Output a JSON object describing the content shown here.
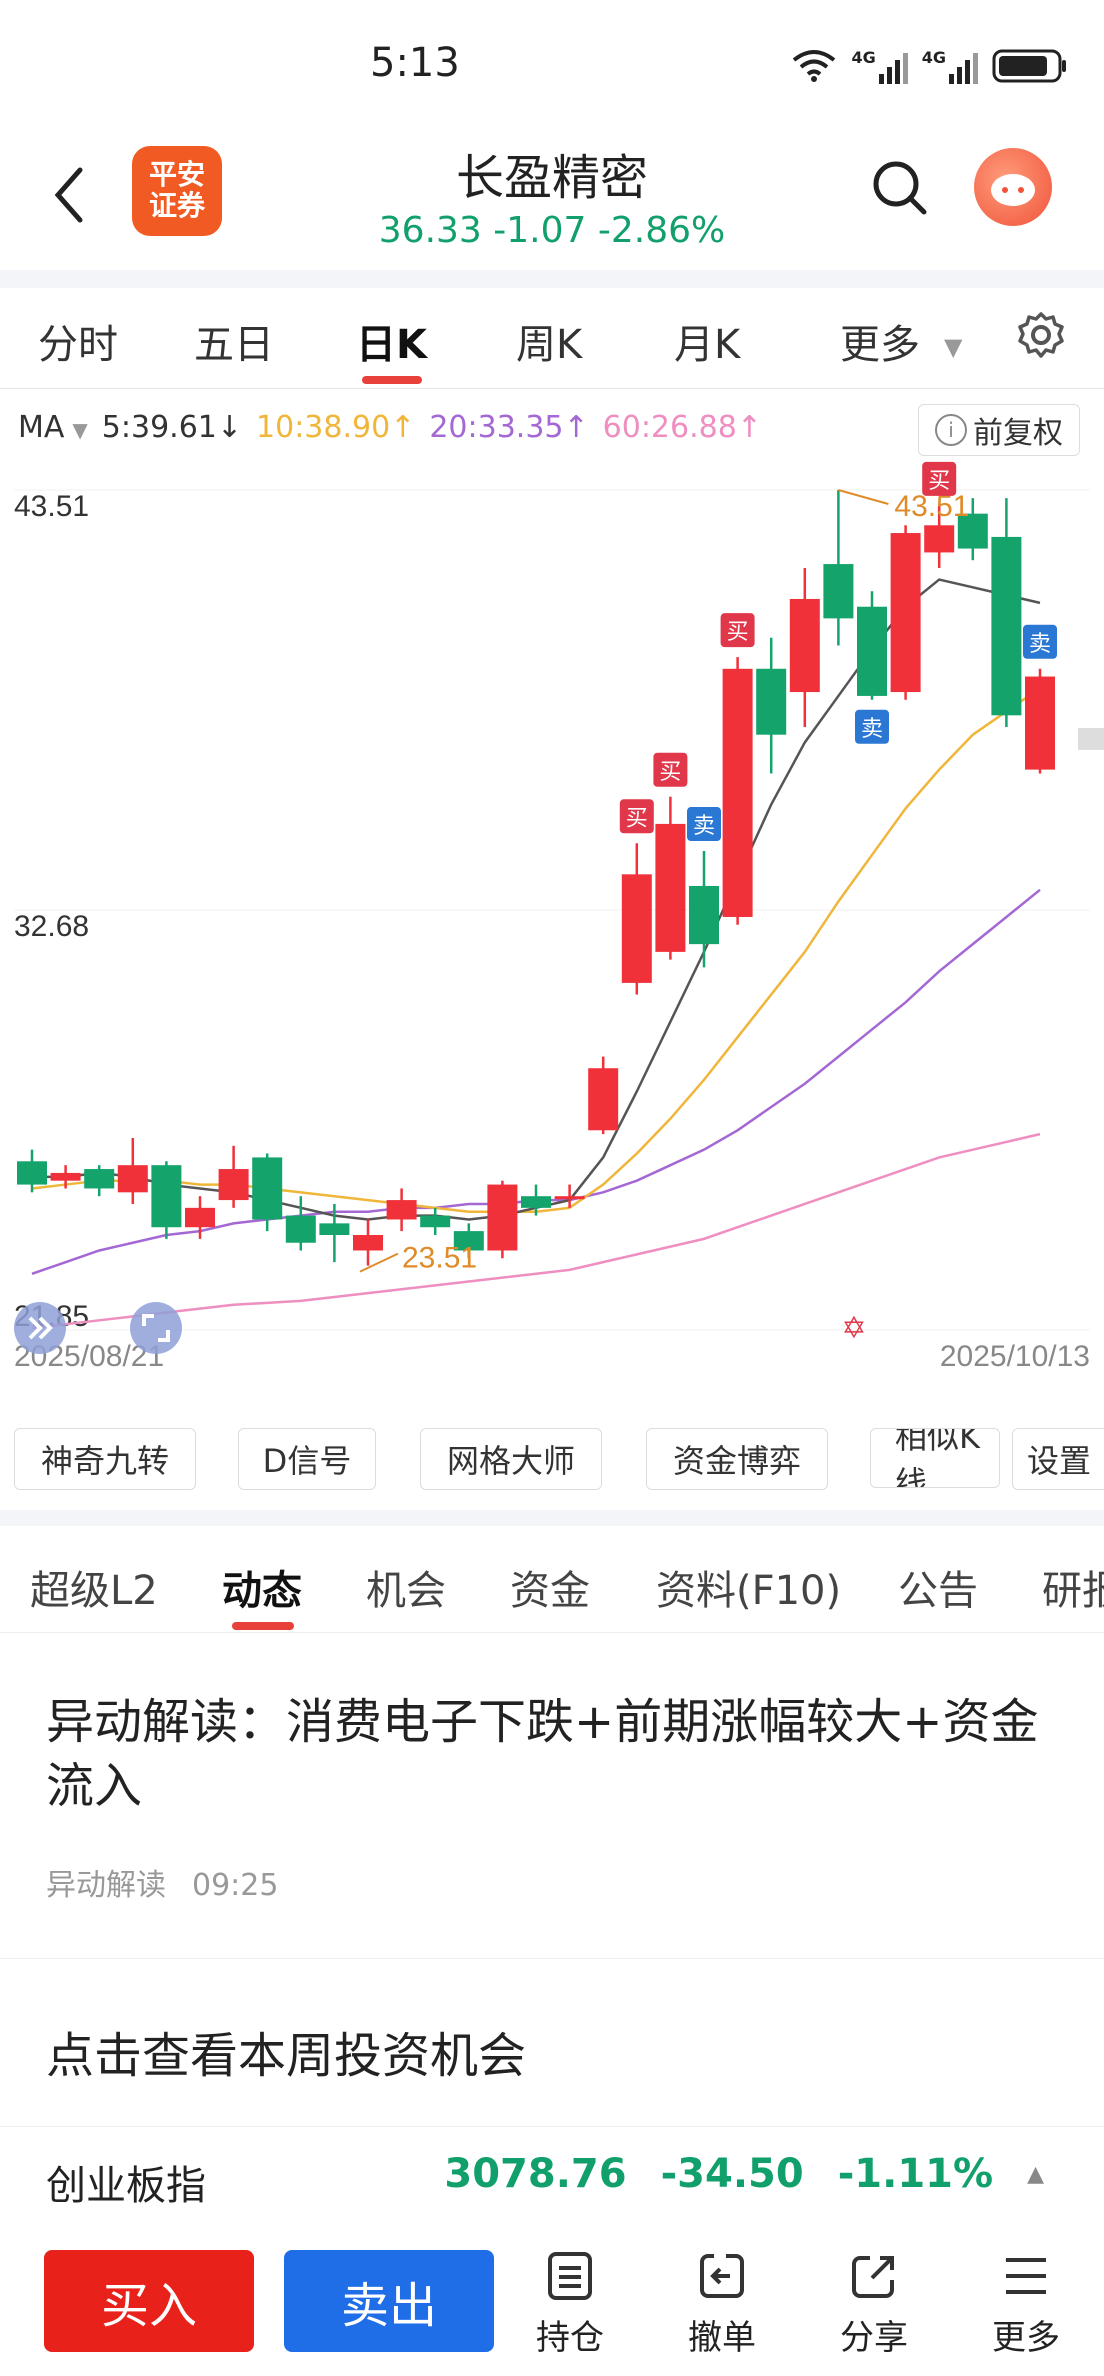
{
  "status": {
    "time": "5:13",
    "net1": "4G",
    "net2": "4G"
  },
  "header": {
    "name": "长盈精密",
    "price_line": "36.33  -1.07  -2.86%",
    "logo_line1": "平安",
    "logo_line2": "证券"
  },
  "tabs": [
    {
      "label": "分时"
    },
    {
      "label": "五日"
    },
    {
      "label": "日K"
    },
    {
      "label": "周K"
    },
    {
      "label": "月K"
    },
    {
      "label": "更多"
    }
  ],
  "ma": {
    "label": "MA",
    "ma5": "5:39.61↓",
    "ma10": "10:38.90↑",
    "ma20": "20:33.35↑",
    "ma60": "60:26.88↑",
    "adjust": "前复权"
  },
  "colors": {
    "up": "#f0313a",
    "down": "#13a36b",
    "ma5": "#555555",
    "ma10": "#f0b63a",
    "ma20": "#a468d4",
    "ma60": "#ef8ec0",
    "accent": "#e8413a",
    "blue": "#1f6ee8"
  },
  "chart_data": {
    "type": "candlestick",
    "y_ticks": [
      "43.51",
      "32.68",
      "21.85"
    ],
    "ylim": [
      21.85,
      43.51
    ],
    "x_start": "2025/08/21",
    "x_end": "2025/10/13",
    "min_label": "23.51",
    "max_label": "43.51",
    "candles": [
      {
        "o": 26.2,
        "c": 25.6,
        "h": 26.5,
        "l": 25.4
      },
      {
        "o": 25.7,
        "c": 25.9,
        "h": 26.1,
        "l": 25.5
      },
      {
        "o": 26.0,
        "c": 25.5,
        "h": 26.1,
        "l": 25.3
      },
      {
        "o": 25.4,
        "c": 26.1,
        "h": 26.8,
        "l": 25.1
      },
      {
        "o": 26.1,
        "c": 24.5,
        "h": 26.2,
        "l": 24.2
      },
      {
        "o": 24.5,
        "c": 25.0,
        "h": 25.3,
        "l": 24.2
      },
      {
        "o": 25.2,
        "c": 26.0,
        "h": 26.6,
        "l": 25.0
      },
      {
        "o": 26.3,
        "c": 24.7,
        "h": 26.4,
        "l": 24.4
      },
      {
        "o": 24.8,
        "c": 24.1,
        "h": 25.3,
        "l": 23.9
      },
      {
        "o": 24.6,
        "c": 24.3,
        "h": 25.1,
        "l": 23.6
      },
      {
        "o": 23.9,
        "c": 24.3,
        "h": 24.7,
        "l": 23.51
      },
      {
        "o": 24.7,
        "c": 25.2,
        "h": 25.5,
        "l": 24.4
      },
      {
        "o": 24.8,
        "c": 24.5,
        "h": 25.0,
        "l": 24.3
      },
      {
        "o": 24.4,
        "c": 23.9,
        "h": 24.6,
        "l": 23.7
      },
      {
        "o": 23.9,
        "c": 25.6,
        "h": 25.7,
        "l": 23.7
      },
      {
        "o": 25.3,
        "c": 25.0,
        "h": 25.6,
        "l": 24.8
      },
      {
        "o": 25.3,
        "c": 25.3,
        "h": 25.6,
        "l": 25.0
      },
      {
        "o": 27.0,
        "c": 28.6,
        "h": 28.9,
        "l": 26.9
      },
      {
        "o": 30.8,
        "c": 33.6,
        "h": 34.4,
        "l": 30.5
      },
      {
        "o": 31.6,
        "c": 34.9,
        "h": 35.6,
        "l": 31.4
      },
      {
        "o": 33.3,
        "c": 31.8,
        "h": 34.2,
        "l": 31.2
      },
      {
        "o": 32.5,
        "c": 38.9,
        "h": 39.2,
        "l": 32.3
      },
      {
        "o": 38.9,
        "c": 37.2,
        "h": 39.7,
        "l": 36.2
      },
      {
        "o": 38.3,
        "c": 40.7,
        "h": 41.5,
        "l": 37.4
      },
      {
        "o": 41.6,
        "c": 40.2,
        "h": 43.51,
        "l": 39.5
      },
      {
        "o": 40.5,
        "c": 38.2,
        "h": 40.9,
        "l": 38.1
      },
      {
        "o": 38.3,
        "c": 42.4,
        "h": 42.6,
        "l": 38.1
      },
      {
        "o": 41.9,
        "c": 42.6,
        "h": 43.1,
        "l": 41.5
      },
      {
        "o": 42.9,
        "c": 42.0,
        "h": 43.3,
        "l": 41.7
      },
      {
        "o": 42.3,
        "c": 37.7,
        "h": 43.3,
        "l": 37.4
      },
      {
        "o": 36.3,
        "c": 38.7,
        "h": 38.9,
        "l": 36.2
      }
    ],
    "ma5": [
      25.8,
      25.8,
      25.9,
      25.8,
      25.6,
      25.5,
      25.4,
      25.2,
      25.0,
      24.8,
      24.7,
      24.8,
      24.8,
      24.7,
      24.8,
      25.0,
      25.2,
      26.3,
      28.0,
      29.8,
      31.6,
      33.5,
      35.4,
      37.0,
      38.2,
      39.4,
      40.5,
      41.2,
      41.0,
      40.8,
      40.6
    ],
    "ma10": [
      25.5,
      25.6,
      25.7,
      25.7,
      25.7,
      25.6,
      25.6,
      25.5,
      25.4,
      25.3,
      25.2,
      25.1,
      25.0,
      24.9,
      24.9,
      24.9,
      25.0,
      25.6,
      26.4,
      27.3,
      28.3,
      29.4,
      30.5,
      31.6,
      32.9,
      34.1,
      35.3,
      36.3,
      37.2,
      37.8,
      38.4
    ],
    "ma20": [
      23.3,
      23.6,
      23.9,
      24.1,
      24.3,
      24.4,
      24.6,
      24.7,
      24.8,
      24.9,
      24.9,
      25.0,
      25.0,
      25.1,
      25.1,
      25.2,
      25.2,
      25.4,
      25.7,
      26.1,
      26.5,
      27.0,
      27.6,
      28.2,
      28.9,
      29.6,
      30.3,
      31.1,
      31.8,
      32.5,
      33.2
    ],
    "ma60": [
      21.9,
      22.0,
      22.1,
      22.2,
      22.3,
      22.4,
      22.5,
      22.55,
      22.6,
      22.7,
      22.8,
      22.9,
      23.0,
      23.1,
      23.2,
      23.3,
      23.4,
      23.6,
      23.8,
      24.0,
      24.2,
      24.5,
      24.8,
      25.1,
      25.4,
      25.7,
      26.0,
      26.3,
      26.5,
      26.7,
      26.9
    ],
    "signals": [
      {
        "i": 18,
        "type": "买",
        "side": "above"
      },
      {
        "i": 19,
        "type": "买",
        "side": "above"
      },
      {
        "i": 20,
        "type": "卖",
        "side": "above"
      },
      {
        "i": 21,
        "type": "买",
        "side": "above"
      },
      {
        "i": 25,
        "type": "卖",
        "side": "below"
      },
      {
        "i": 27,
        "type": "买",
        "side": "above"
      },
      {
        "i": 30,
        "type": "卖",
        "side": "above"
      }
    ]
  },
  "tools": [
    "神奇九转",
    "D信号",
    "网格大师",
    "资金博弈",
    "相似K线",
    "设置"
  ],
  "tabs2": [
    "超级L2",
    "动态",
    "机会",
    "资金",
    "资料(F10)",
    "公告",
    "研报"
  ],
  "news": {
    "title": "异动解读：消费电子下跌+前期涨幅较大+资金流入",
    "source": "异动解读",
    "time": "09:25"
  },
  "promo": "点击查看本周投资机会",
  "index": {
    "name": "创业板指",
    "value": "3078.76",
    "change": "-34.50",
    "pct": "-1.11%"
  },
  "bottom": {
    "buy": "买入",
    "sell": "卖出",
    "hold": "持仓",
    "cancel": "撤单",
    "share": "分享",
    "more": "更多"
  }
}
